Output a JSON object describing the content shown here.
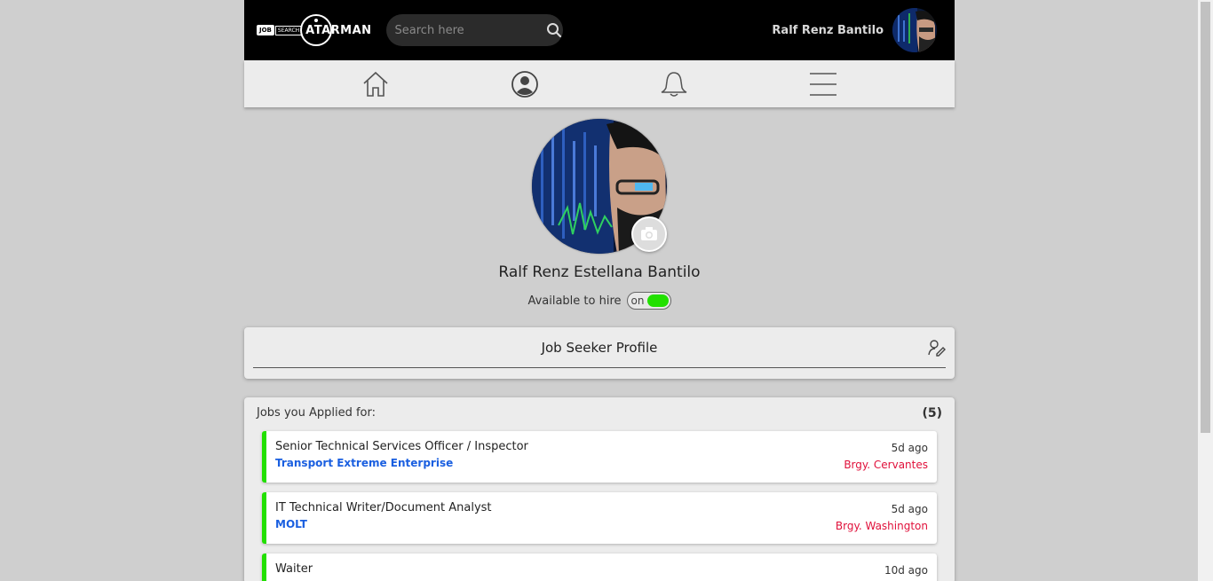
{
  "header": {
    "logo_prefix": "JOB",
    "logo_mid": "SEARCH",
    "logo_name": "ATARMAN",
    "search_placeholder": "Search here",
    "user_name": "Ralf Renz Bantilo"
  },
  "nav": {
    "items": [
      "home-icon",
      "profile-icon",
      "bell-icon",
      "menu-icon"
    ]
  },
  "profile": {
    "full_name": "Ralf Renz Estellana Bantilo",
    "hire_label": "Available to hire",
    "toggle_state": "on",
    "toggle_color": "#22e000"
  },
  "seeker": {
    "title": "Job Seeker Profile"
  },
  "applied": {
    "label": "Jobs you Applied for:",
    "count": "(5)",
    "jobs": [
      {
        "title": "Senior Technical Services Officer / Inspector",
        "company": "Transport Extreme Enterprise",
        "ago": "5d ago",
        "location": "Brgy. Cervantes"
      },
      {
        "title": "IT Technical Writer/Document Analyst",
        "company": "MOLT",
        "ago": "5d ago",
        "location": "Brgy. Washington"
      },
      {
        "title": "Waiter",
        "company": "",
        "ago": "10d ago",
        "location": ""
      }
    ]
  },
  "colors": {
    "company": "#1a5fe0",
    "location": "#e0103a",
    "accent": "#22e000"
  }
}
